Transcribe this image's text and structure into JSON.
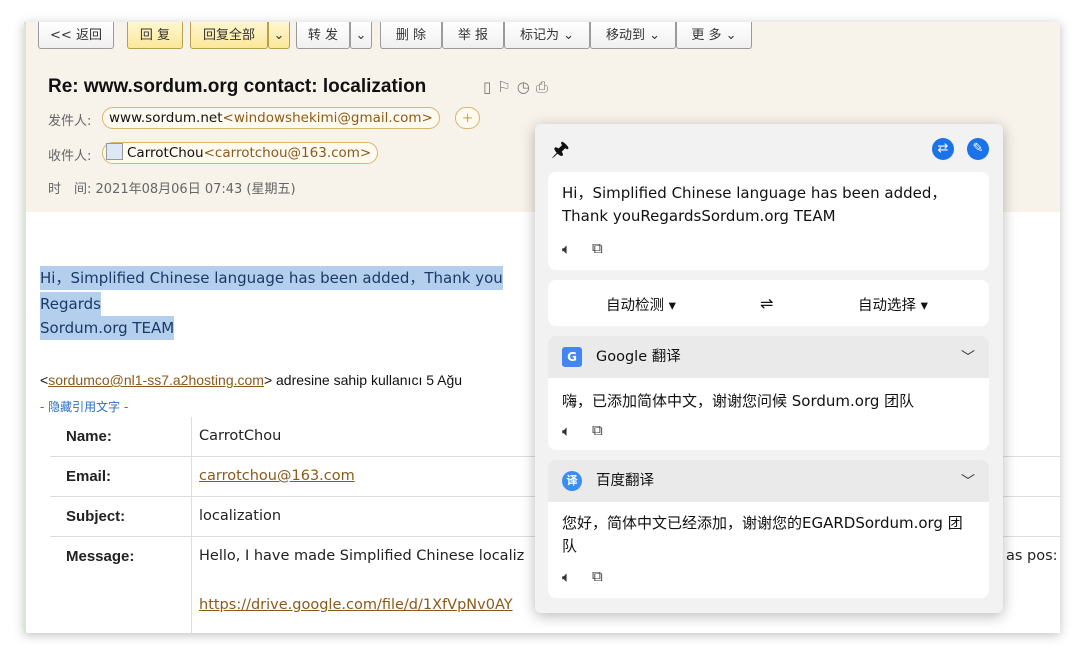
{
  "toolbar": {
    "back": "<< 返回",
    "reply": "回 复",
    "reply_all": "回复全部",
    "forward": "转 发",
    "delete": "删 除",
    "report": "举 报",
    "mark_as": "标记为 ⌄",
    "move_to": "移动到 ⌄",
    "more": "更 多 ⌄",
    "caret": "⌄"
  },
  "mail": {
    "subject": "Re: www.sordum.org contact: localization",
    "from_label": "发件人:",
    "from_name": "www.sordum.net",
    "from_addr": "<windowshekimi@gmail.com>",
    "from_add": "+",
    "to_label": "收件人:",
    "to_name": "CarrotChou",
    "to_addr": "<carrotchou@163.com>",
    "time_label": "时　间:",
    "time_value": "2021年08月06日 07:43 (星期五)",
    "body_line1": "Hi，Simplified Chinese language has been added，Thank you",
    "body_line2": "Regards",
    "body_line3": "Sordum.org TEAM",
    "quote_prefix": "<",
    "quote_link": "sordumco@nl1-ss7.a2hosting.com",
    "quote_suffix": "> adresine sahip kullanıcı 5 Ağu",
    "hidden_quote": "- 隐藏引用文字 -",
    "table": [
      {
        "label": "Name:",
        "value": "CarrotChou"
      },
      {
        "label": "Email:",
        "value": "carrotchou@163.com"
      },
      {
        "label": "Subject:",
        "value": "localization"
      },
      {
        "label": "Message:",
        "value": "Hello, I have made Simplified Chinese localiz"
      }
    ],
    "message_tail": "as pos:",
    "message_link": "https://drive.google.com/file/d/1XfVpNv0AY"
  },
  "translator": {
    "source_text": "Hi，Simplified Chinese language has been added，Thank youRegardsSordum.org TEAM",
    "source_lang": "自动检测 ▾",
    "swap": "⇌",
    "target_lang": "自动选择 ▾",
    "google_name": "Google 翻译",
    "google_result": "嗨，已添加简体中文，谢谢您问候 Sordum.org 团队",
    "baidu_name": "百度翻译",
    "baidu_result": "您好，简体中文已经添加，谢谢您的EGARDSordum.org 团队"
  }
}
